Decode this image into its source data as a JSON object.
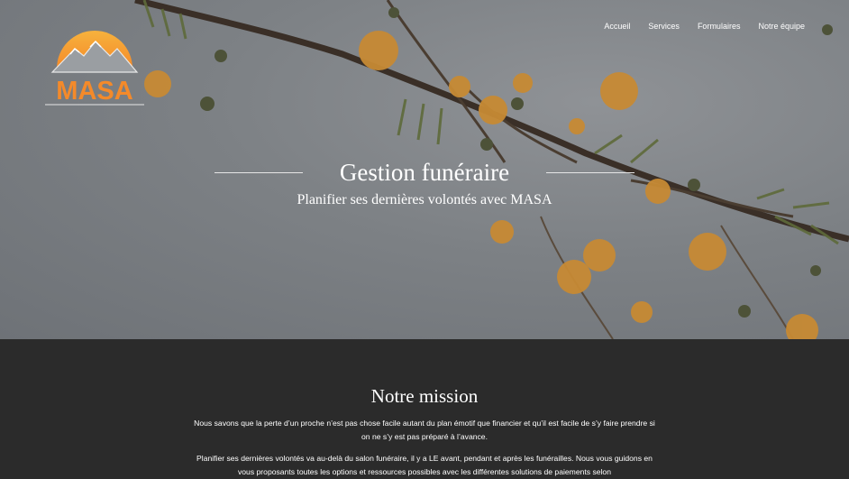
{
  "brand": {
    "logo_text": "MASA",
    "colors": {
      "orange": "#f6a13a",
      "dark": "#2b2b2b",
      "hero": "#7d8185"
    }
  },
  "nav": {
    "items": [
      "Accueil",
      "Services",
      "Formulaires",
      "Notre équipe"
    ]
  },
  "hero": {
    "title": "Gestion funéraire",
    "subtitle": "Planifier ses dernières volontés avec MASA"
  },
  "mission": {
    "heading": "Notre mission",
    "paragraphs": [
      "Nous savons que la perte d’un proche n’est pas chose facile autant du plan émotif que financier et qu’il est facile de s’y faire prendre si on ne s’y est pas préparé à l’avance.",
      "Planifier ses dernières volontés va au-delà du salon funéraire, il y a LE avant, pendant et après les funérailles. Nous vous guidons en vous proposants toutes les options et ressources possibles avec les différentes solutions de paiements selon"
    ]
  }
}
